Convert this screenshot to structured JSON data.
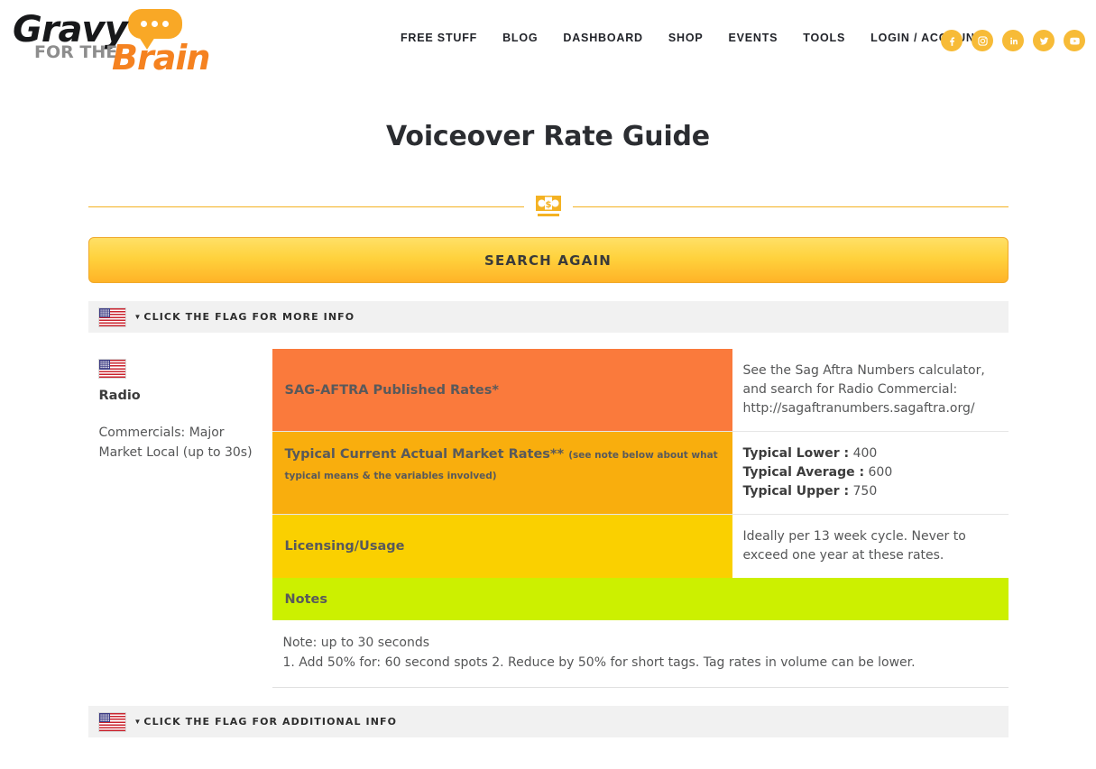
{
  "header": {
    "logo": {
      "word1": "Gravy",
      "word2": "FOR THE",
      "word3": "Brain",
      "bubble_icon": "speech-bubble-icon"
    },
    "nav": [
      {
        "label": "FREE STUFF"
      },
      {
        "label": "BLOG"
      },
      {
        "label": "DASHBOARD"
      },
      {
        "label": "SHOP"
      },
      {
        "label": "EVENTS"
      },
      {
        "label": "TOOLS"
      },
      {
        "label": "LOGIN / ACCOUNT"
      }
    ],
    "social": [
      {
        "name": "facebook-icon",
        "glyph": "f"
      },
      {
        "name": "instagram-icon",
        "glyph": ""
      },
      {
        "name": "linkedin-icon",
        "glyph": "in"
      },
      {
        "name": "twitter-icon",
        "glyph": ""
      },
      {
        "name": "youtube-icon",
        "glyph": ""
      }
    ],
    "social_color": "#f7bb37"
  },
  "page": {
    "title": "Voiceover Rate Guide",
    "divider_icon": "money-bill-icon",
    "divider_color": "#f4b223"
  },
  "search_button": {
    "label": "SEARCH AGAIN"
  },
  "accordion_top": {
    "caret": "▼",
    "label": "CLICK THE FLAG FOR MORE INFO",
    "flag_icon": "us-flag-icon"
  },
  "accordion_bottom": {
    "caret": "▼",
    "label": "CLICK THE FLAG FOR ADDITIONAL INFO",
    "flag_icon": "us-flag-icon"
  },
  "rate_card": {
    "flag_icon": "us-flag-icon",
    "category": "Radio",
    "description": "Commercials: Major Market Local (up to 30s)",
    "rows": [
      {
        "label": "SAG-AFTRA Published Rates*",
        "sublabel": "",
        "color": "#fa7a3c",
        "value": "See the Sag Aftra Numbers calculator, and search for Radio Commercial: http://sagaftranumbers.sagaftra.org/"
      },
      {
        "label": "Typical Current Actual Market Rates**",
        "sublabel": "(see note below about what typical means & the variables involved)",
        "color": "#f9ae0d",
        "value_lines": [
          {
            "key": "Typical Lower :",
            "val": "400"
          },
          {
            "key": "Typical Average :",
            "val": "600"
          },
          {
            "key": "Typical Upper :",
            "val": "750"
          }
        ]
      },
      {
        "label": "Licensing/Usage",
        "sublabel": "",
        "color": "#fad000",
        "value": "Ideally per 13 week cycle. Never to exceed one year at these rates."
      }
    ],
    "notes": {
      "header": "Notes",
      "header_color": "#ccf000",
      "line1": "Note: up to 30 seconds",
      "line2": "1. Add 50% for: 60 second spots 2. Reduce by 50% for short tags. Tag rates in volume can be lower."
    }
  }
}
